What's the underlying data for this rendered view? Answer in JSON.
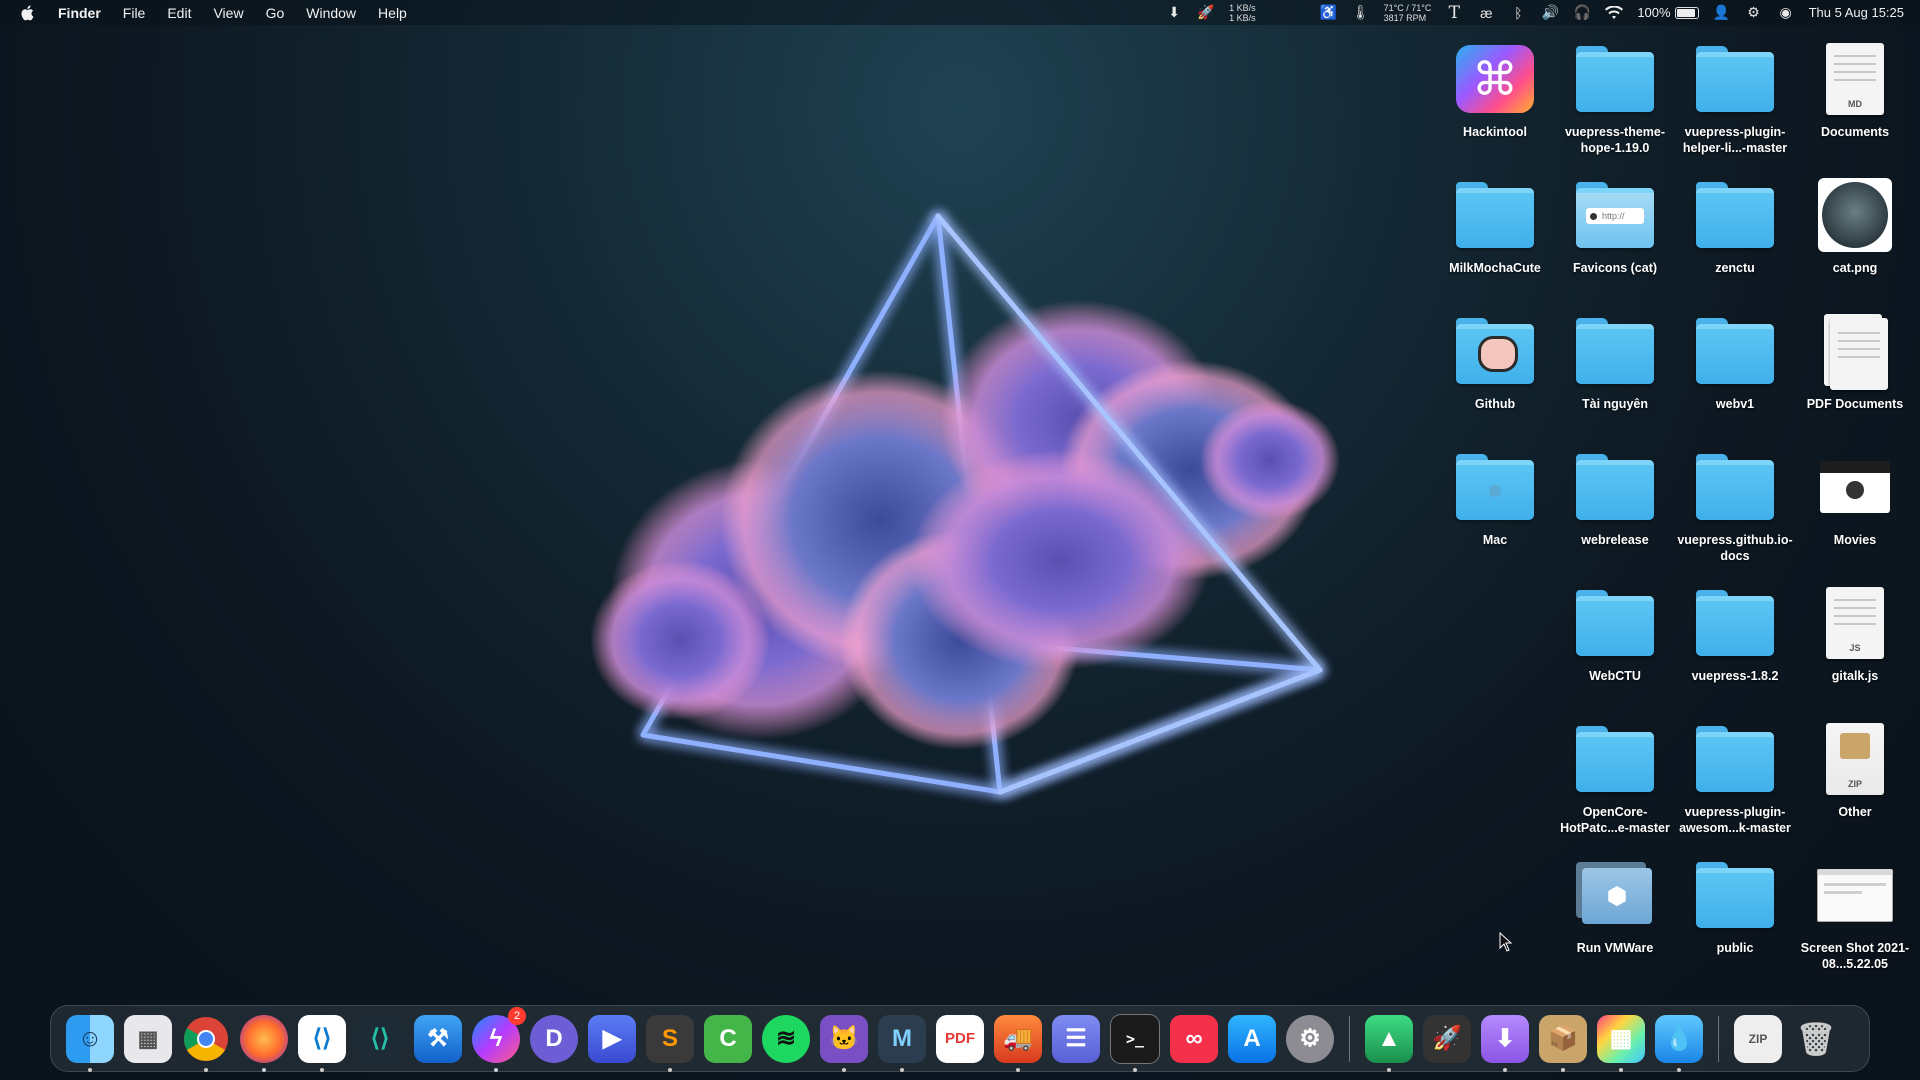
{
  "menubar": {
    "app_name": "Finder",
    "menus": [
      "File",
      "Edit",
      "View",
      "Go",
      "Window",
      "Help"
    ],
    "network_up": "1 KB/s",
    "network_down": "1 KB/s",
    "temperature": "71°C / 71°C",
    "fan_speed": "3817 RPM",
    "battery_percent": "100%",
    "datetime": "Thu 5 Aug  15:25"
  },
  "desktop": {
    "items": [
      {
        "label": "Hackintool",
        "kind": "app"
      },
      {
        "label": "vuepress-theme-hope-1.19.0",
        "kind": "folder"
      },
      {
        "label": "vuepress-plugin-helper-li...-master",
        "kind": "folder"
      },
      {
        "label": "Documents",
        "kind": "doc",
        "tag": "MD"
      },
      {
        "label": "MilkMochaCute",
        "kind": "folder"
      },
      {
        "label": "Favicons (cat)",
        "kind": "folder-url",
        "tag": "http://"
      },
      {
        "label": "zenctu",
        "kind": "folder"
      },
      {
        "label": "cat.png",
        "kind": "image"
      },
      {
        "label": "Github",
        "kind": "folder-github"
      },
      {
        "label": "Tài nguyên",
        "kind": "folder"
      },
      {
        "label": "webv1",
        "kind": "folder"
      },
      {
        "label": "PDF Documents",
        "kind": "doc-stack"
      },
      {
        "label": "Mac",
        "kind": "folder-apple"
      },
      {
        "label": "webrelease",
        "kind": "folder"
      },
      {
        "label": "vuepress.github.io-docs",
        "kind": "folder"
      },
      {
        "label": "Movies",
        "kind": "screen"
      },
      {
        "label": "WebCTU",
        "kind": "folder"
      },
      {
        "label": "vuepress-1.8.2",
        "kind": "folder"
      },
      {
        "label": "gitalk.js",
        "kind": "doc",
        "tag": "JS"
      },
      {
        "label": "OpenCore-HotPatc...e-master",
        "kind": "folder"
      },
      {
        "label": "vuepress-plugin-awesom...k-master",
        "kind": "folder"
      },
      {
        "label": "Other",
        "kind": "zip",
        "tag": "ZIP"
      },
      {
        "label": "Run VMWare",
        "kind": "vm"
      },
      {
        "label": "public",
        "kind": "folder"
      },
      {
        "label": "Screen Shot 2021-08...5.22.05",
        "kind": "screenshot"
      }
    ]
  },
  "dock": {
    "messenger_badge": "2",
    "pdf_label": "PDF",
    "zip_label": "ZIP",
    "terminal_prompt": ">_"
  },
  "colors": {
    "folder_blue": "#4ab3ea",
    "neon": "#7aa0ff",
    "badge_red": "#ff3b30"
  }
}
